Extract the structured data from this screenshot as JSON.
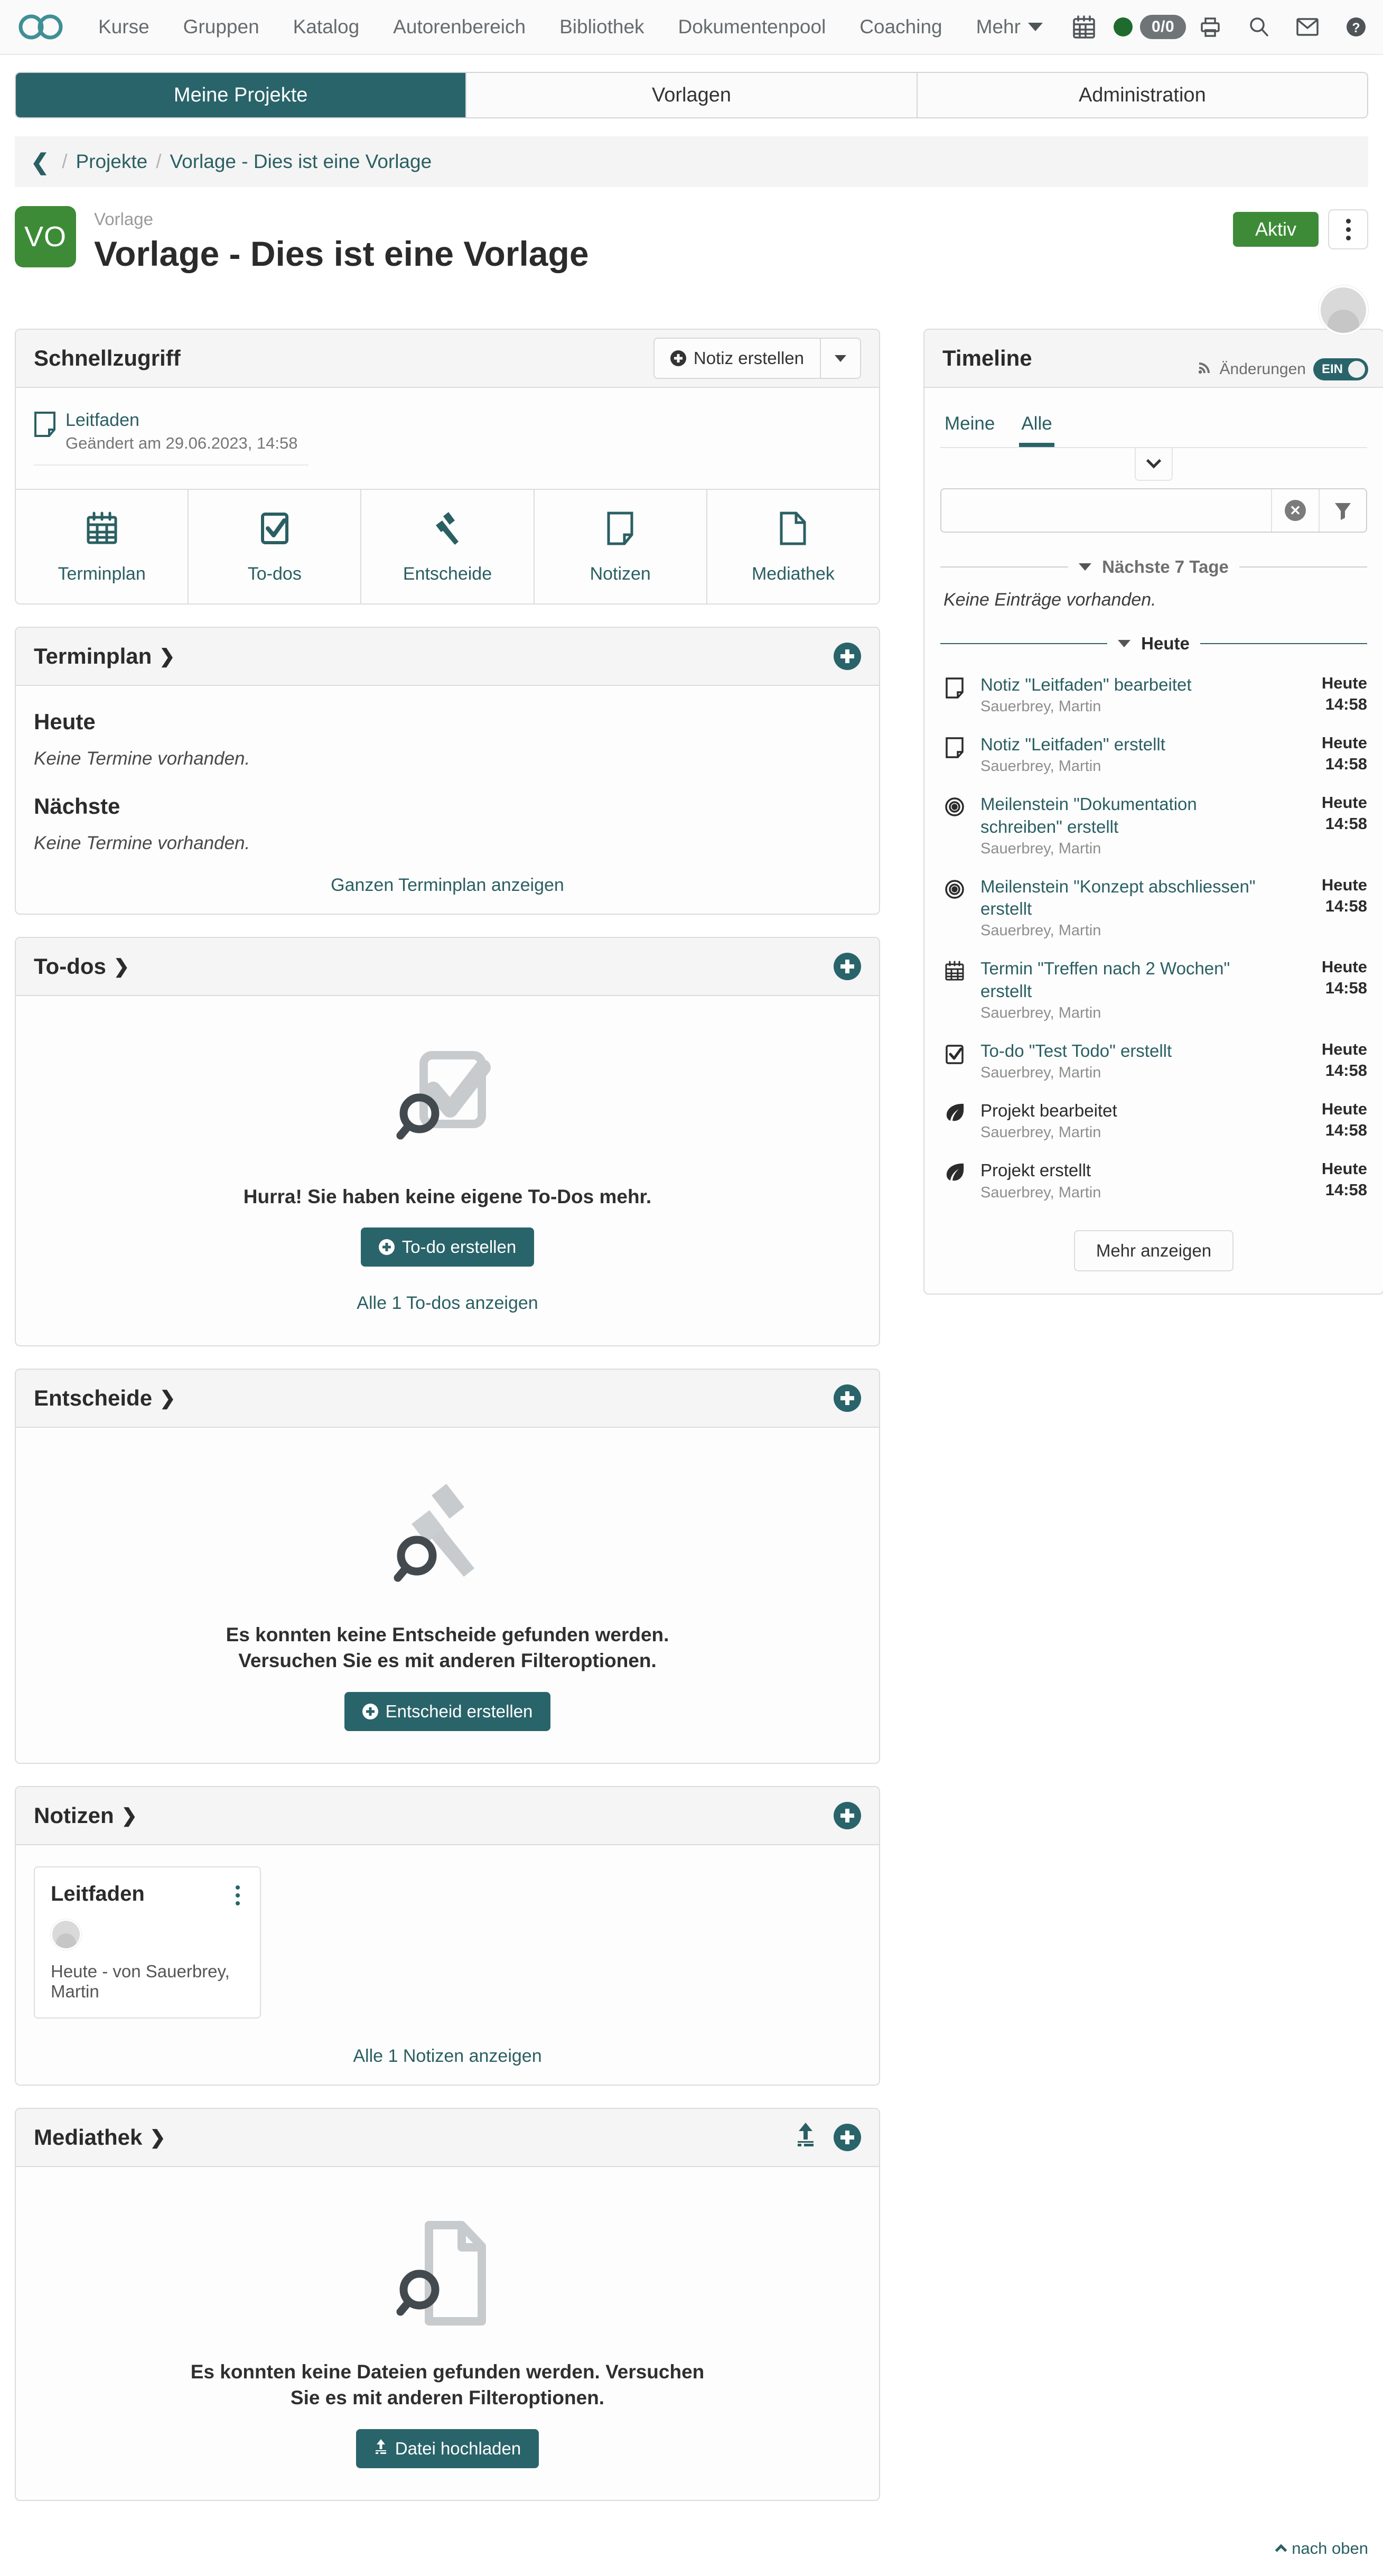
{
  "navbar": {
    "logo": "infinity-logo",
    "links": [
      "Kurse",
      "Gruppen",
      "Katalog",
      "Autorenbereich",
      "Bibliothek",
      "Dokumentenpool",
      "Coaching"
    ],
    "more_label": "Mehr",
    "icons": [
      "calendar-icon",
      "status-dot-icon",
      "assessment-counter",
      "print-icon",
      "search-icon",
      "mail-icon",
      "help-icon",
      "avatar"
    ],
    "counter_badge": "0/0"
  },
  "segments": [
    {
      "label": "Meine Projekte",
      "active": true
    },
    {
      "label": "Vorlagen",
      "active": false
    },
    {
      "label": "Administration",
      "active": false
    }
  ],
  "breadcrumb": {
    "back": "❮",
    "items": [
      "Projekte",
      "Vorlage - Dies ist eine Vorlage"
    ]
  },
  "project": {
    "avatar_initials": "VO",
    "kicker": "Vorlage",
    "title": "Vorlage - Dies ist eine Vorlage",
    "status_badge": "Aktiv",
    "changes_label": "Änderungen",
    "changes_toggle": "EIN"
  },
  "quick_access": {
    "title": "Schnellzugriff",
    "create_note_button": "Notiz erstellen",
    "recent": {
      "name": "Leitfaden",
      "meta": "Geändert am 29.06.2023, 14:58",
      "icon": "note-icon"
    },
    "tiles": [
      {
        "label": "Terminplan",
        "icon": "calendar-icon"
      },
      {
        "label": "To-dos",
        "icon": "checkbox-icon"
      },
      {
        "label": "Entscheide",
        "icon": "gavel-icon"
      },
      {
        "label": "Notizen",
        "icon": "note-icon"
      },
      {
        "label": "Mediathek",
        "icon": "file-icon"
      }
    ]
  },
  "appointments": {
    "title": "Terminplan",
    "today_heading": "Heute",
    "today_empty": "Keine Termine vorhanden.",
    "next_heading": "Nächste",
    "next_empty": "Keine Termine vorhanden.",
    "show_all_link": "Ganzen Terminplan anzeigen"
  },
  "todos": {
    "title": "To-dos",
    "empty_message": "Hurra! Sie haben keine eigene To-Dos mehr.",
    "create_button": "To-do erstellen",
    "show_all_link": "Alle 1 To-dos anzeigen"
  },
  "decisions": {
    "title": "Entscheide",
    "empty_message": "Es konnten keine Entscheide gefunden werden. Versuchen Sie es mit anderen Filteroptionen.",
    "create_button": "Entscheid erstellen"
  },
  "notes": {
    "title": "Notizen",
    "card": {
      "title": "Leitfaden",
      "meta": "Heute - von Sauerbrey, Martin"
    },
    "show_all_link": "Alle 1 Notizen anzeigen"
  },
  "media": {
    "title": "Mediathek",
    "empty_message": "Es konnten keine Dateien gefunden werden. Versuchen Sie es mit anderen Filteroptionen.",
    "upload_button": "Datei hochladen"
  },
  "timeline": {
    "title": "Timeline",
    "tabs": [
      {
        "label": "Meine",
        "active": false
      },
      {
        "label": "Alle",
        "active": true
      }
    ],
    "filter_placeholder": "",
    "filter_value": "",
    "next7_label": "Nächste 7 Tage",
    "next7_empty": "Keine Einträge vorhanden.",
    "today_label": "Heute",
    "entries": [
      {
        "icon": "note-icon",
        "text": "Notiz \"Leitfaden\" bearbeitet",
        "link": true,
        "who": "Sauerbrey, Martin",
        "day": "Heute",
        "time": "14:58"
      },
      {
        "icon": "note-icon",
        "text": "Notiz \"Leitfaden\" erstellt",
        "link": true,
        "who": "Sauerbrey, Martin",
        "day": "Heute",
        "time": "14:58"
      },
      {
        "icon": "milestone-icon",
        "text": "Meilenstein \"Dokumentation schreiben\" erstellt",
        "link": true,
        "who": "Sauerbrey, Martin",
        "day": "Heute",
        "time": "14:58"
      },
      {
        "icon": "milestone-icon",
        "text": "Meilenstein \"Konzept abschliessen\" erstellt",
        "link": true,
        "who": "Sauerbrey, Martin",
        "day": "Heute",
        "time": "14:58"
      },
      {
        "icon": "calendar-icon",
        "text": "Termin \"Treffen nach 2 Wochen\" erstellt",
        "link": true,
        "who": "Sauerbrey, Martin",
        "day": "Heute",
        "time": "14:58"
      },
      {
        "icon": "checkbox-icon",
        "text": "To-do \"Test Todo\" erstellt",
        "link": true,
        "who": "Sauerbrey, Martin",
        "day": "Heute",
        "time": "14:58"
      },
      {
        "icon": "leaf-icon",
        "text": "Projekt bearbeitet",
        "link": false,
        "who": "Sauerbrey, Martin",
        "day": "Heute",
        "time": "14:58"
      },
      {
        "icon": "leaf-icon",
        "text": "Projekt erstellt",
        "link": false,
        "who": "Sauerbrey, Martin",
        "day": "Heute",
        "time": "14:58"
      }
    ],
    "more_button": "Mehr anzeigen"
  },
  "footer": {
    "back_to_top": "nach oben"
  },
  "colors": {
    "accent_teal": "#29646a",
    "status_green": "#3d8b37",
    "link_teal": "#2a5f63",
    "muted_gray": "#8a8a8a"
  }
}
